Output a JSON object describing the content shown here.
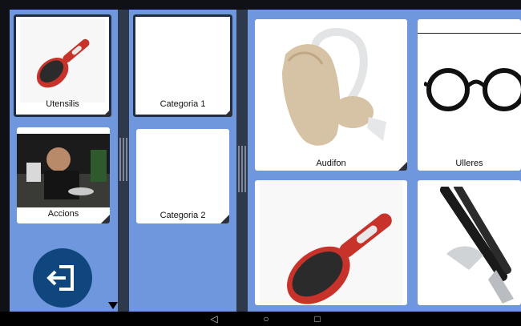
{
  "left_column": {
    "items": [
      {
        "label": "Utensilis",
        "image": "hairbrush",
        "selected": true
      },
      {
        "label": "Accions",
        "image": "person-eating",
        "selected": false
      }
    ],
    "exit_icon": "exit-icon"
  },
  "middle_column": {
    "items": [
      {
        "label": "Categoria 1",
        "selected": true
      },
      {
        "label": "Categoria 2",
        "selected": false
      }
    ]
  },
  "grid": {
    "items": [
      {
        "label": "Audifon",
        "image": "hearing-aid"
      },
      {
        "label": "Ulleres",
        "image": "glasses"
      },
      {
        "label": "",
        "image": "hairbrush"
      },
      {
        "label": "",
        "image": "nail-clipper"
      }
    ]
  },
  "navbar": {
    "back": "◁",
    "home": "○",
    "recents": "□"
  },
  "colors": {
    "panel": "#6f97de",
    "divider": "#2e394c",
    "exit_button": "#0f467e"
  }
}
